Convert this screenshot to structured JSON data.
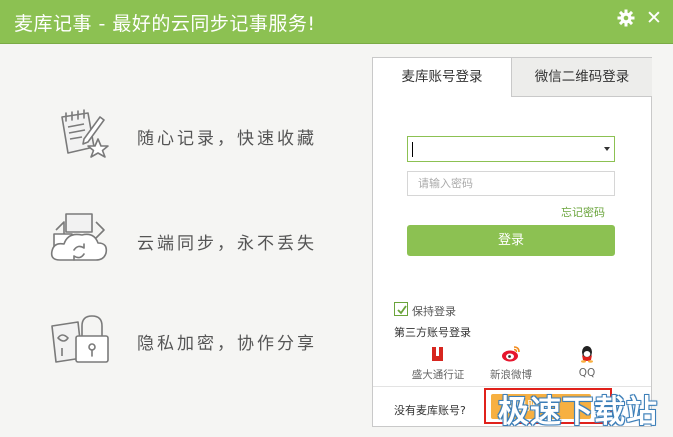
{
  "window": {
    "title": "麦库记事 - 最好的云同步记事服务!"
  },
  "features": [
    {
      "icon": "notepad-star-icon",
      "label": "随心记录，快速收藏"
    },
    {
      "icon": "cloud-sync-icon",
      "label": "云端同步，永不丢失"
    },
    {
      "icon": "padlock-icon",
      "label": "隐私加密，协作分享"
    }
  ],
  "tabs": {
    "account": "麦库账号登录",
    "wechat": "微信二维码登录"
  },
  "form": {
    "account_value": "",
    "password_placeholder": "请输入密码",
    "forgot": "忘记密码",
    "login": "登录",
    "remember": "保持登录",
    "third_party_title": "第三方账号登录"
  },
  "third_party": [
    {
      "icon": "shanda-icon",
      "label": "盛大通行证"
    },
    {
      "icon": "weibo-icon",
      "label": "新浪微博"
    },
    {
      "icon": "qq-icon",
      "label": "QQ"
    }
  ],
  "footer": {
    "no_account": "没有麦库账号?",
    "register": "注册账号"
  },
  "watermark": "极速下载站",
  "colors": {
    "accent": "#8cc152",
    "register": "#f7b041",
    "highlight": "#e0211b"
  }
}
